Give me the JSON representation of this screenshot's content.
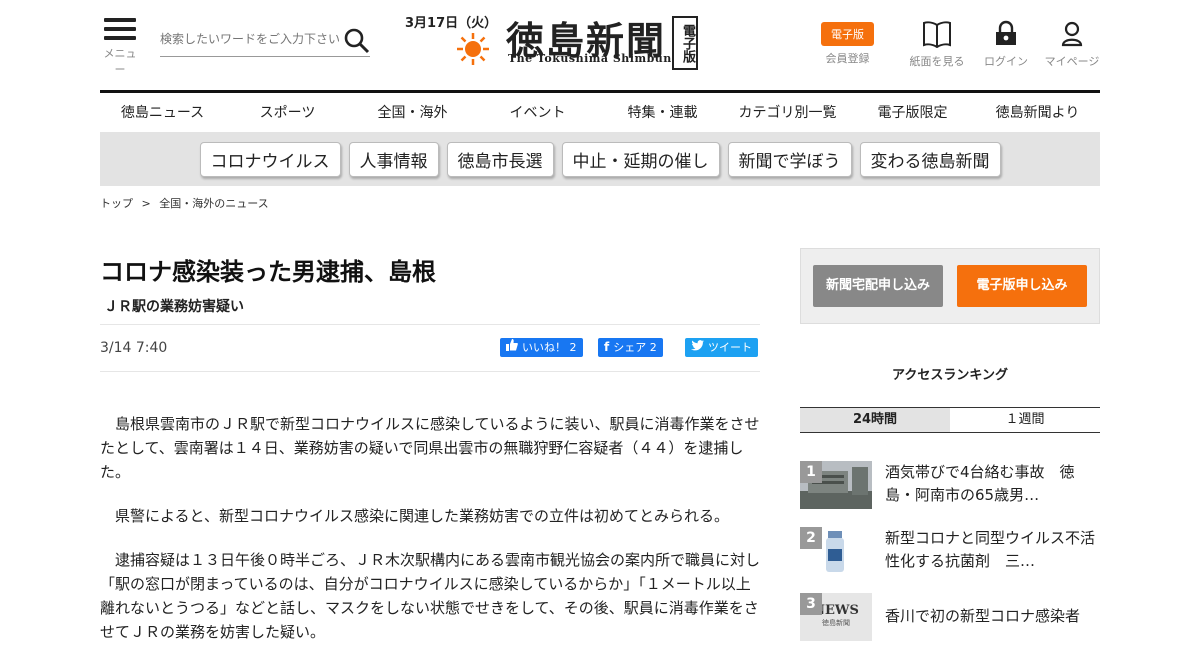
{
  "header": {
    "menu_label": "メニュー",
    "search_placeholder": "検索したいワードをご入力下さい",
    "date": "3月17日（火）",
    "logo_title": "徳島新聞",
    "logo_badge": "電子版",
    "logo_sub": "The Tokushima Shimbun",
    "digital_pill": "電子版",
    "register_label": "会員登録",
    "paper_label": "紙面を見る",
    "login_label": "ログイン",
    "mypage_label": "マイページ"
  },
  "nav": [
    "徳島ニュース",
    "スポーツ",
    "全国・海外",
    "イベント",
    "特集・連載",
    "カテゴリ別一覧",
    "電子版限定",
    "徳島新聞より"
  ],
  "tags": [
    "コロナウイルス",
    "人事情報",
    "徳島市長選",
    "中止・延期の催し",
    "新聞で学ぼう",
    "変わる徳島新聞"
  ],
  "breadcrumb": {
    "top": "トップ",
    "sep": ">",
    "current": "全国・海外のニュース"
  },
  "article": {
    "headline": "コロナ感染装った男逮捕、島根",
    "subhead": "ＪＲ駅の業務妨害疑い",
    "timestamp": "3/14 7:40",
    "like_label": "いいね！ 2",
    "share_label": "シェア 2",
    "tweet_label": "ツイート",
    "paragraphs": [
      "島根県雲南市のＪＲ駅で新型コロナウイルスに感染しているように装い、駅員に消毒作業をさせたとして、雲南署は１４日、業務妨害の疑いで同県出雲市の無職狩野仁容疑者（４４）を逮捕した。",
      "県警によると、新型コロナウイルス感染に関連した業務妨害での立件は初めてとみられる。",
      "逮捕容疑は１３日午後０時半ごろ、ＪＲ木次駅構内にある雲南市観光協会の案内所で職員に対し「駅の窓口が閉まっているのは、自分がコロナウイルスに感染しているからか」「１メートル以上離れないとうつる」などと話し、マスクをしない状態でせきをして、その後、駅員に消毒作業をさせてＪＲの業務を妨害した疑い。"
    ]
  },
  "sidebar": {
    "delivery_button": "新聞宅配申し込み",
    "digital_button": "電子版申し込み",
    "ranking_title": "アクセスランキング",
    "tab_24h": "24時間",
    "tab_week": "１週間",
    "ranking": [
      {
        "rank": "1",
        "title": "酒気帯びで4台絡む事故　徳島・阿南市の65歳男…"
      },
      {
        "rank": "2",
        "title": "新型コロナと同型ウイルス不活性化する抗菌剤　三…"
      },
      {
        "rank": "3",
        "title": "香川で初の新型コロナ感染者",
        "thumb_text": "NEWS",
        "thumb_sub": "徳島新聞"
      }
    ]
  },
  "colors": {
    "accent": "#f5700d",
    "facebook": "#1877f2",
    "twitter": "#1da1f2"
  }
}
